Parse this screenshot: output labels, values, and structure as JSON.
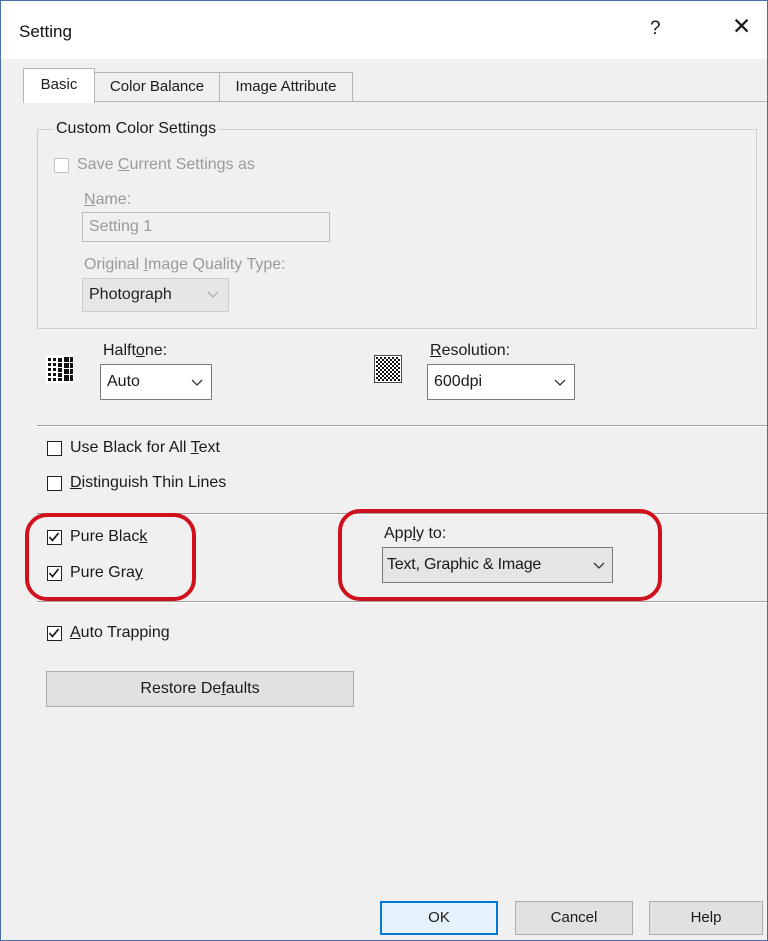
{
  "window": {
    "title": "Setting",
    "help_glyph": "?",
    "close_glyph": "✕"
  },
  "tabs": [
    {
      "label": "Basic",
      "selected": true
    },
    {
      "label": "Color Balance",
      "selected": false
    },
    {
      "label": "Image Attribute",
      "selected": false
    }
  ],
  "custom_color": {
    "group_label": "Custom Color Settings",
    "save_label_pre": "Save ",
    "save_label_ul": "C",
    "save_label_post": "urrent Settings as",
    "name_label_ul": "N",
    "name_label_post": "ame:",
    "name_value": "Setting 1",
    "quality_label_pre": "Original ",
    "quality_label_ul": "I",
    "quality_label_post": "mage Quality Type:",
    "quality_value": "Photograph"
  },
  "halftone": {
    "label_pre": "Halft",
    "label_ul": "o",
    "label_post": "ne:",
    "value": "Auto",
    "icon": "halftone-pattern-icon"
  },
  "resolution": {
    "label_ul": "R",
    "label_post": "esolution:",
    "value": "600dpi",
    "icon": "resolution-pattern-icon"
  },
  "checks": {
    "use_black": {
      "pre": "Use Black for All ",
      "ul": "T",
      "post": "ext",
      "checked": false
    },
    "thin_lines": {
      "pre": "",
      "ul": "D",
      "post": "istinguish Thin Lines",
      "checked": false
    },
    "pure_black": {
      "pre": "Pure Blac",
      "ul": "k",
      "post": "",
      "checked": true
    },
    "pure_gray": {
      "pre": "Pure Gra",
      "ul": "y",
      "post": "",
      "checked": true
    },
    "auto_trapping": {
      "pre": "",
      "ul": "A",
      "post": "uto Trapping",
      "checked": true
    }
  },
  "apply_to": {
    "label_pre": "App",
    "label_ul": "l",
    "label_post": "y to:",
    "value": "Text, Graphic & Image"
  },
  "restore": {
    "pre": "Restore De",
    "ul": "f",
    "post": "aults"
  },
  "buttons": {
    "ok": "OK",
    "cancel": "Cancel",
    "help": "Help"
  },
  "colors": {
    "highlight": "#d0101c",
    "disabled_text": "#9a9a9a",
    "accent_border": "#0078d7"
  }
}
